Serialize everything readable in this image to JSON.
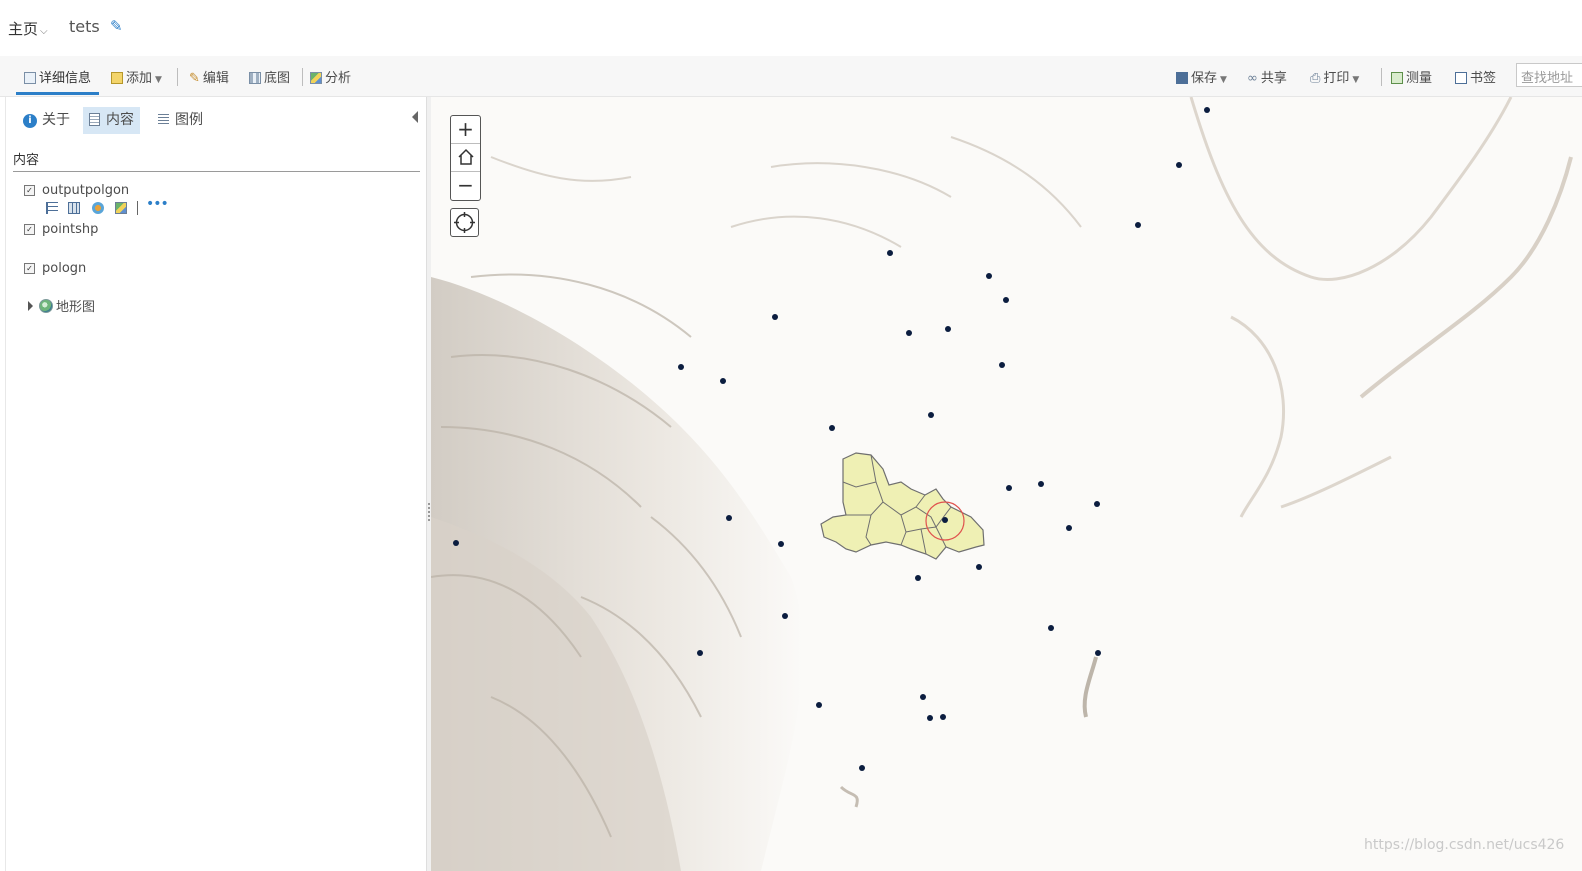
{
  "header": {
    "home_label": "主页",
    "map_title": "tets"
  },
  "toolbar": {
    "details": "详细信息",
    "add": "添加",
    "edit": "编辑",
    "basemap": "底图",
    "analysis": "分析",
    "save": "保存",
    "share": "共享",
    "print": "打印",
    "measure": "测量",
    "bookmarks": "书签",
    "search_placeholder": "查找地址"
  },
  "sidebar": {
    "tabs": {
      "about": "关于",
      "content": "内容",
      "legend": "图例"
    },
    "content_heading": "内容",
    "layers": [
      {
        "name": "outputpolgon",
        "checked": true
      },
      {
        "name": "pointshp",
        "checked": true
      },
      {
        "name": "pologn",
        "checked": true
      }
    ],
    "basemap_layer": "地形图"
  },
  "map": {
    "zoom_in": "+",
    "zoom_out": "−",
    "point_color": "#0b1d3f",
    "polygon_fill": "#eff0b4",
    "polygon_stroke": "#6f6f6f",
    "highlight_color": "#e0524e",
    "watermark": "https://blog.csdn.net/ucs426"
  }
}
